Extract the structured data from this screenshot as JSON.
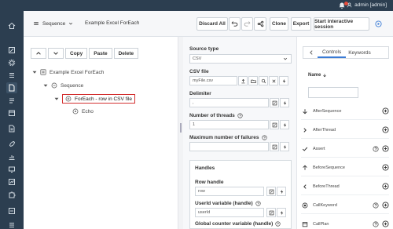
{
  "topbar": {
    "user": "admin [admin]"
  },
  "header": {
    "plan_type": "Sequence",
    "plan_name": "Example Excel ForEach",
    "discard": "Discard All",
    "clone": "Clone",
    "export": "Export",
    "start": "Start interactive session"
  },
  "tree": {
    "buttons": {
      "copy": "Copy",
      "paste": "Paste",
      "delete": "Delete"
    },
    "root": "Example Excel ForEach",
    "sequence": "Sequence",
    "foreach": "ForEach - row in CSV file",
    "echo": "Echo"
  },
  "props": {
    "source_type_label": "Source type",
    "source_type_value": "CSV",
    "csv_file_label": "CSV file",
    "csv_file_value": "myFile.csv",
    "delimiter_label": "Delimiter",
    "delimiter_value": ",",
    "threads_label": "Number of threads",
    "threads_value": "1",
    "max_failures_label": "Maximum number of failures",
    "max_failures_value": "",
    "handles_label": "Handles",
    "row_handle_label": "Row handle",
    "row_handle_value": "row",
    "userid_label": "UserId variable (handle)",
    "userid_value": "userId",
    "global_counter_label": "Global counter variable (handle)"
  },
  "palette": {
    "tabs": [
      "Controls",
      "Keywords"
    ],
    "name_header": "Name",
    "search_value": "",
    "items": [
      {
        "label": "AfterSequence",
        "icon": "arrow-down-icon",
        "help": false
      },
      {
        "label": "AfterThread",
        "icon": "chevron-right-icon",
        "help": false
      },
      {
        "label": "Assert",
        "icon": "check-icon",
        "help": true
      },
      {
        "label": "BeforeSequence",
        "icon": "arrow-up-icon",
        "help": false
      },
      {
        "label": "BeforeThread",
        "icon": "chevron-left-icon",
        "help": false
      },
      {
        "label": "CallKeyword",
        "icon": "target-icon",
        "help": true
      },
      {
        "label": "CallPlan",
        "icon": "calendar-icon",
        "help": true
      }
    ]
  },
  "colors": {
    "rail": "#2c3e50",
    "selection_border": "#d32f2f",
    "accent": "#3a7bd5"
  }
}
